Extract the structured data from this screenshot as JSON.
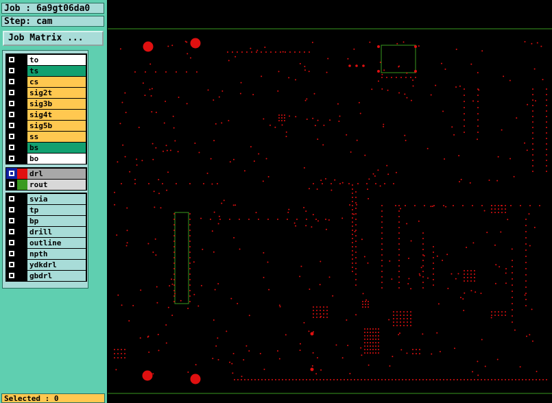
{
  "job_label": "Job : 6a9gt06da0",
  "step_label": "Step: cam",
  "job_matrix_button": "Job Matrix ...",
  "board_layers": [
    {
      "name": "to",
      "color": "#ffffff"
    },
    {
      "name": "ts",
      "color": "#12a070"
    },
    {
      "name": "cs",
      "color": "#ffc850"
    },
    {
      "name": "sig2t",
      "color": "#ffc850"
    },
    {
      "name": "sig3b",
      "color": "#ffc850"
    },
    {
      "name": "sig4t",
      "color": "#ffc850"
    },
    {
      "name": "sig5b",
      "color": "#ffc850"
    },
    {
      "name": "ss",
      "color": "#ffc850"
    },
    {
      "name": "bs",
      "color": "#12a070"
    },
    {
      "name": "bo",
      "color": "#ffffff"
    }
  ],
  "active_layers": [
    {
      "name": "drl",
      "color": "#a8a8a8",
      "swatch": "#e01010",
      "checked": true
    },
    {
      "name": "rout",
      "color": "#d8d8d8",
      "swatch": "#3a9a20",
      "checked": false
    }
  ],
  "misc_layers": [
    {
      "name": "svia",
      "color": "#a8dcd8"
    },
    {
      "name": "tp",
      "color": "#a8dcd8"
    },
    {
      "name": "bp",
      "color": "#a8dcd8"
    },
    {
      "name": "drill",
      "color": "#a8dcd8"
    },
    {
      "name": "outline",
      "color": "#a8dcd8"
    },
    {
      "name": "npth",
      "color": "#a8dcd8"
    },
    {
      "name": "ydkdrl",
      "color": "#a8dcd8"
    },
    {
      "name": "gbdrl",
      "color": "#a8dcd8"
    }
  ],
  "selected_label": "Selected : 0",
  "colors": {
    "panel": "#5fcfb0",
    "drill": "#e01010",
    "outline": "#3a9a20",
    "canvas": "#000000"
  }
}
